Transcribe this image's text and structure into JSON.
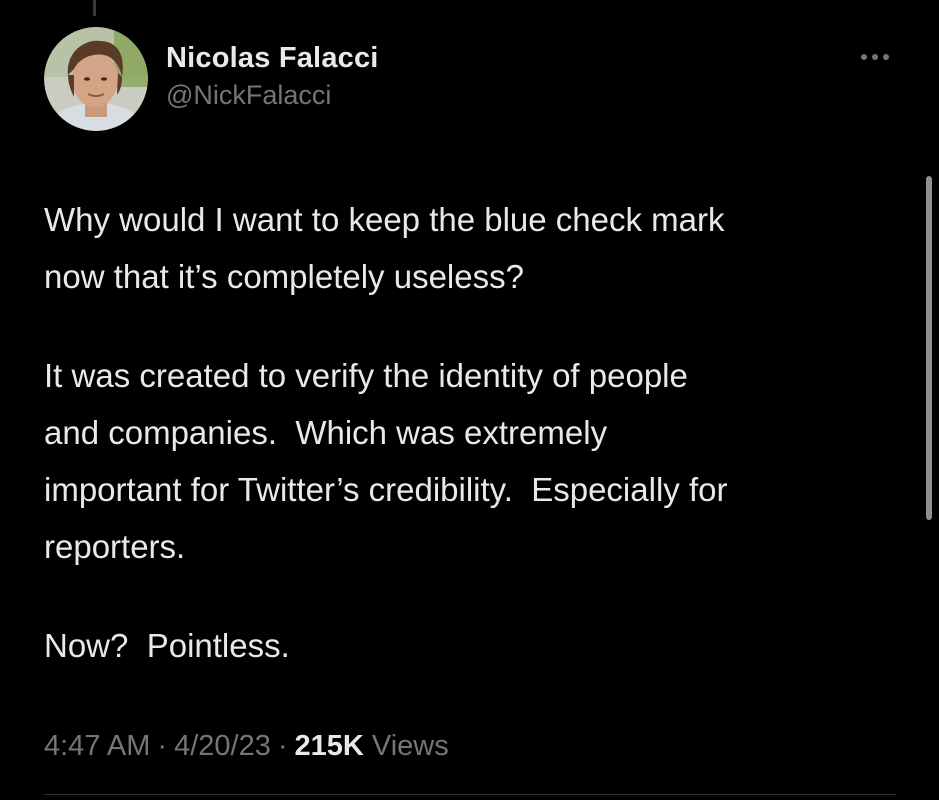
{
  "tweet": {
    "author": {
      "display_name": "Nicolas Falacci",
      "handle": "@NickFalacci",
      "avatar": "profile-photo"
    },
    "more_icon": "more-horizontal-icon",
    "paragraphs": [
      "Why would I want to keep the blue check mark\nnow that it’s completely useless?",
      "It was created to verify the identity of people\nand companies.  Which was extremely\nimportant for Twitter’s credibility.  Especially for\nreporters.",
      "Now?  Pointless."
    ],
    "meta": {
      "time": "4:47 AM",
      "separator": "·",
      "date": "4/20/23",
      "views_count": "215K",
      "views_label": "Views"
    }
  },
  "colors": {
    "background": "#000000",
    "text_primary": "#e7e9ea",
    "text_secondary": "#71767b",
    "divider": "#2f3336"
  }
}
